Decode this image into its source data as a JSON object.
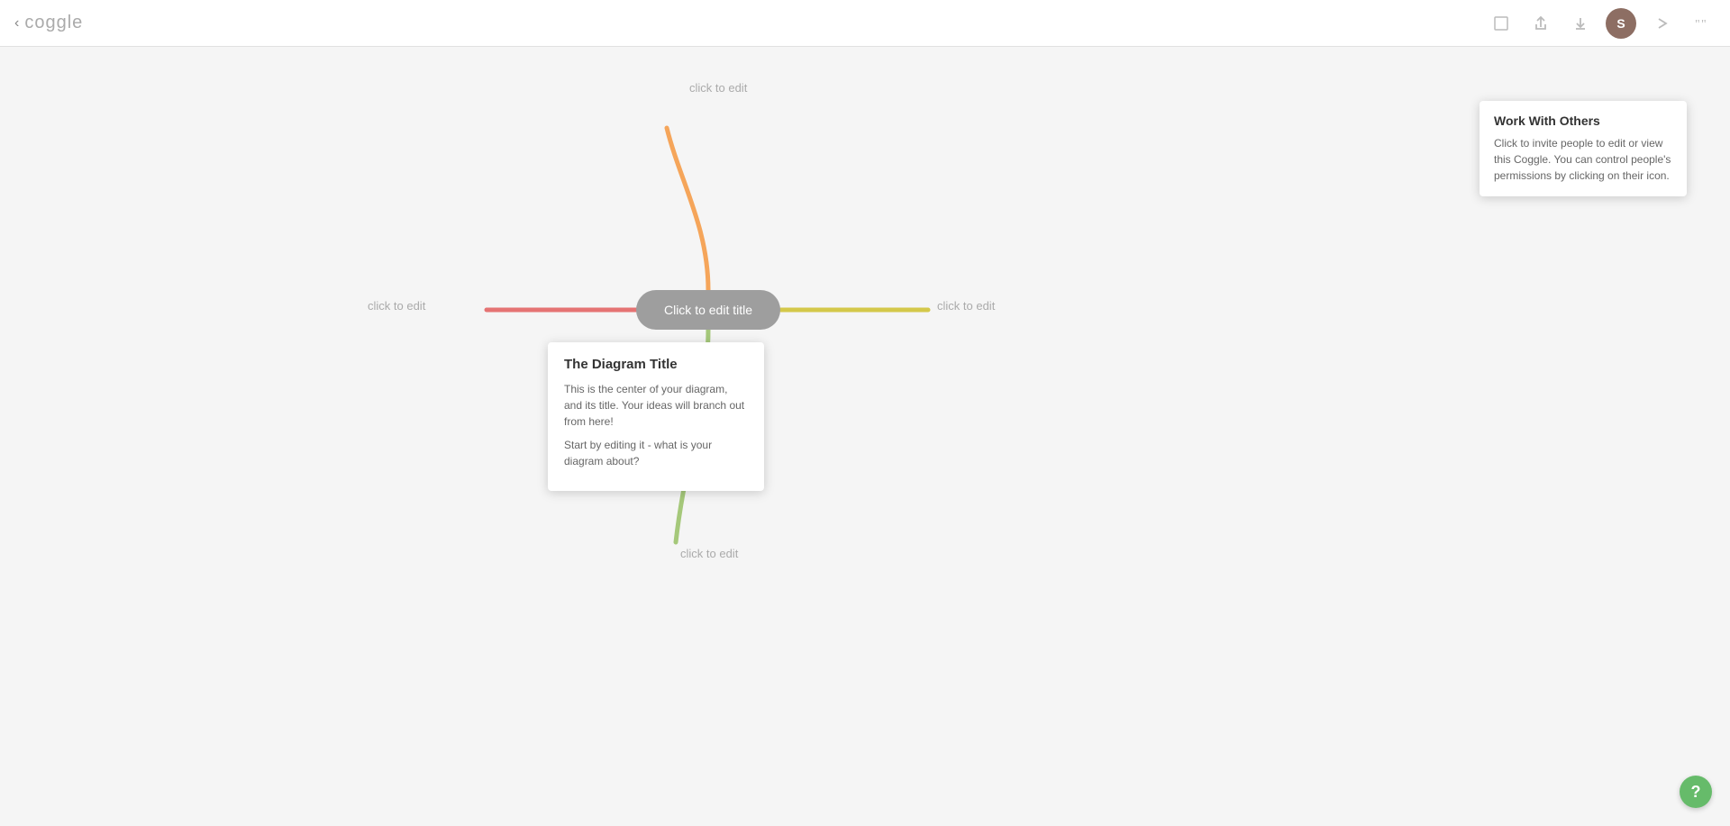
{
  "toolbar": {
    "back_arrow": "‹",
    "logo": "coggle",
    "fullscreen_icon": "⬜",
    "share_icon": "↑",
    "download_icon": "↓",
    "avatar_label": "S",
    "present_icon": "→",
    "quote_icon": "❝"
  },
  "work_tooltip": {
    "title": "Work With Others",
    "body": "Click to invite people to edit or view this Coggle. You can control people's permissions by clicking on their icon."
  },
  "center_node": {
    "label": "Click to edit title"
  },
  "branches": {
    "top_label": "click to edit",
    "left_label": "click to edit",
    "right_label": "click to edit",
    "bottom_label": "click to edit"
  },
  "center_tooltip": {
    "title": "The Diagram Title",
    "para1": "This is the center of your diagram, and its title. Your ideas will branch out from here!",
    "para2": "Start by editing it - what is your diagram about?"
  },
  "help_btn": "?"
}
